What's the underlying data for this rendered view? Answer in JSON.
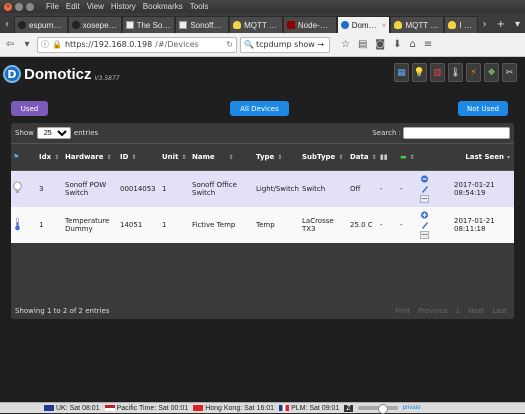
{
  "browser": {
    "menu": [
      "File",
      "Edit",
      "View",
      "History",
      "Bookmarks",
      "Tools"
    ],
    "tabs": [
      {
        "label": "espurn…",
        "icon": "github-icon",
        "active": false
      },
      {
        "label": "xosepe…",
        "icon": "github-icon",
        "active": false
      },
      {
        "label": "The So…",
        "icon": "page-icon",
        "active": false
      },
      {
        "label": "Sonoff…",
        "icon": "page-icon",
        "active": false
      },
      {
        "label": "MQTT …",
        "icon": "bulb-icon",
        "active": false
      },
      {
        "label": "Node-…",
        "icon": "nodered-icon",
        "active": false
      },
      {
        "label": "Dom…",
        "icon": "domoticz-icon",
        "active": true
      },
      {
        "label": "MQTT …",
        "icon": "bulb-icon",
        "active": false
      },
      {
        "label": "I …",
        "icon": "bulb-icon",
        "active": false
      }
    ],
    "url_host": "https://192.168.0.198",
    "url_path": "/#/Devices",
    "search_value": "tcpdump show →"
  },
  "app": {
    "name": "Domoticz",
    "version": "V3.5877",
    "header_icons": [
      "dashboard-icon",
      "lightbulb-icon",
      "temperature-icon",
      "thermometer-icon",
      "utility-icon",
      "custom-icon",
      "settings-icon"
    ]
  },
  "filters": {
    "used": "Used",
    "all": "All Devices",
    "not_used": "Not Used"
  },
  "table": {
    "show_label": "Show",
    "page_size": "25",
    "entries_label": "entries",
    "search_label": "Search :",
    "columns": [
      "Idx",
      "Hardware",
      "ID",
      "Unit",
      "Name",
      "Type",
      "SubType",
      "Data",
      "",
      "",
      "",
      "Last Seen"
    ],
    "rows": [
      {
        "idx": "3",
        "hardware": "Sonoff POW Switch",
        "id": "00014053",
        "unit": "1",
        "name": "Sonoff Office Switch",
        "type": "Light/Switch",
        "subtype": "Switch",
        "data": "Off",
        "signal": "-",
        "battery": "-",
        "last_seen": "2017-01-21 08:54:19"
      },
      {
        "idx": "1",
        "hardware": "Temperature Dummy",
        "id": "14051",
        "unit": "1",
        "name": "Fictive Temp",
        "type": "Temp",
        "subtype": "LaCrosse TX3",
        "data": "25.0 C",
        "signal": "-",
        "battery": "-",
        "last_seen": "2017-01-21 08:11:18"
      }
    ],
    "info": "Showing 1 to 2 of 2 entries",
    "pager": [
      "First",
      "Previous",
      "1",
      "Next",
      "Last"
    ]
  },
  "statusbar": {
    "clocks": [
      {
        "label": "UK: Sat 08:01",
        "flag": "uk-flag-icon"
      },
      {
        "label": "Pacific Time: Sat 00:01",
        "flag": "us-flag-icon"
      },
      {
        "label": "Hong Kong: Sat 16:01",
        "flag": "hk-flag-icon"
      },
      {
        "label": "PLM: Sat 09:01",
        "flag": "fr-flag-icon"
      }
    ],
    "private": "private"
  }
}
